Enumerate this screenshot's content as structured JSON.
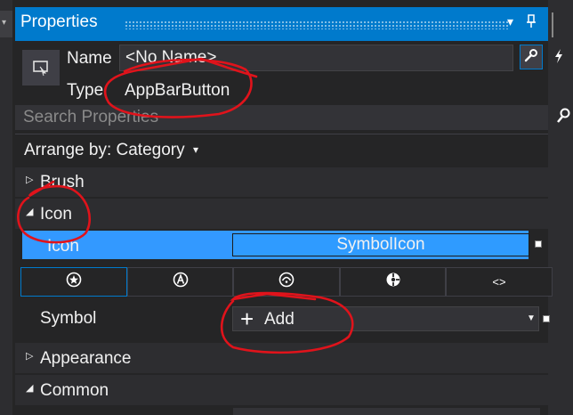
{
  "window": {
    "title": "Properties",
    "buttons": {
      "dropdown": "▾",
      "pin": "📌",
      "close": "✕"
    }
  },
  "element": {
    "name_label": "Name",
    "name_value": "<No Name>",
    "type_label": "Type",
    "type_value": "AppBarButton"
  },
  "search": {
    "placeholder": "Search Properties"
  },
  "arrange": {
    "label": "Arrange by: Category",
    "caret": "▾"
  },
  "categories": {
    "brush": "Brush",
    "icon": "Icon",
    "appearance": "Appearance",
    "common": "Common"
  },
  "icon_property": {
    "label": "Icon",
    "value": "SymbolIcon"
  },
  "icon_tabs": [
    "star-icon",
    "font-icon",
    "path-icon",
    "bitmap-icon",
    "code-icon"
  ],
  "symbol": {
    "label": "Symbol",
    "add_label": "Add",
    "plus": "+"
  },
  "colors": {
    "accent": "#007acc",
    "selection": "#3399ff",
    "background": "#252526",
    "annotation": "#e0131b"
  }
}
